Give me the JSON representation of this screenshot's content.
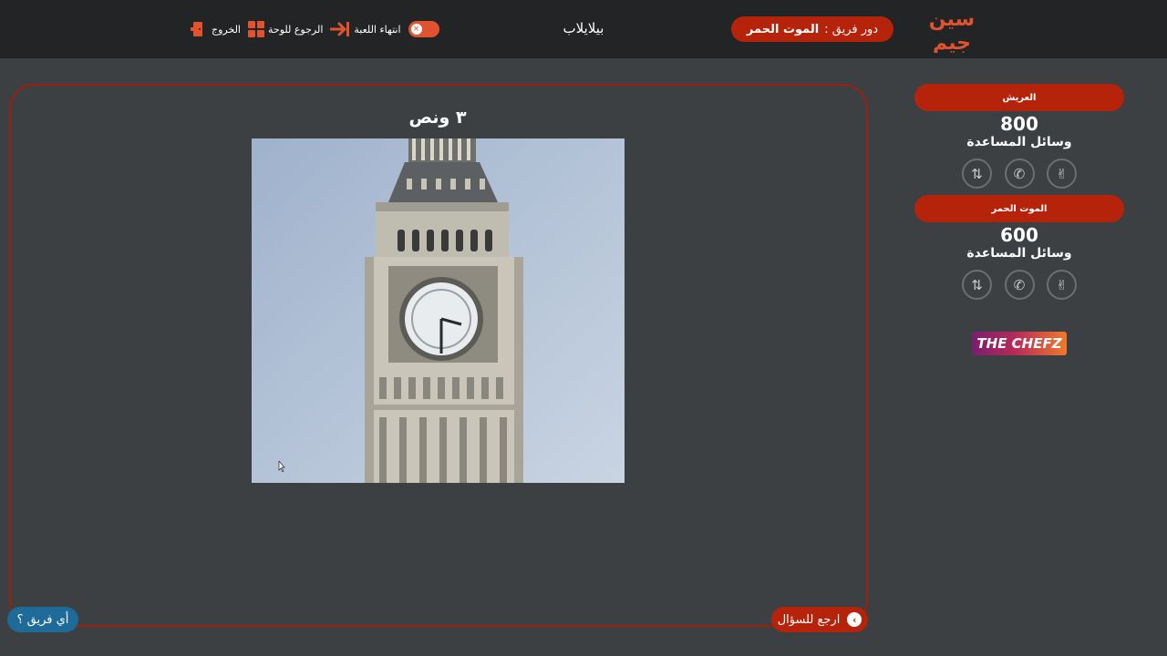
{
  "header": {
    "turn_label": "دور فريق :",
    "turn_team": "الموت الحمر",
    "game_name": "بيلايلاب",
    "actions": {
      "end_game": "انتهاء اللعبة",
      "back_to_board": "الرجوع للوحة",
      "exit": "الخروج"
    },
    "toggle_on": true,
    "brand_colors": {
      "accent": "#e2522e",
      "pill": "#b5230a",
      "bar": "#222425"
    }
  },
  "question": {
    "title": "٣ ونص",
    "image_icon": "big-ben-clock-tower"
  },
  "footer": {
    "back_to_question": "ارجع للسؤال",
    "which_team": "أي فريق ؟"
  },
  "teams": [
    {
      "name": "العريش",
      "score": "800",
      "aids_label": "وسائل المساعدة",
      "aids": [
        "swap-icon",
        "phone-icon",
        "peace-hand-icon"
      ]
    },
    {
      "name": "الموت الحمر",
      "score": "600",
      "aids_label": "وسائل المساعدة",
      "aids": [
        "swap-icon",
        "phone-icon",
        "peace-hand-icon"
      ]
    }
  ],
  "sponsor": {
    "text": "THE CHEFZ"
  }
}
